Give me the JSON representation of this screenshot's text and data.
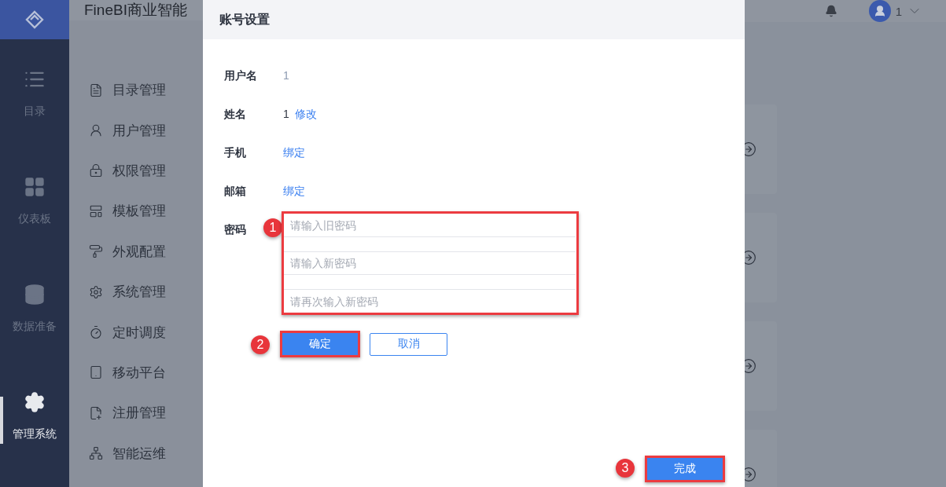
{
  "app": {
    "title": "FineBI商业智能"
  },
  "rail": [
    {
      "label": "目录",
      "selected": false
    },
    {
      "label": "仪表板",
      "selected": false
    },
    {
      "label": "数据准备",
      "selected": false
    },
    {
      "label": "管理系统",
      "selected": true
    }
  ],
  "menu": [
    {
      "label": "目录管理"
    },
    {
      "label": "用户管理"
    },
    {
      "label": "权限管理"
    },
    {
      "label": "模板管理"
    },
    {
      "label": "外观配置"
    },
    {
      "label": "系统管理"
    },
    {
      "label": "定时调度"
    },
    {
      "label": "移动平台"
    },
    {
      "label": "注册管理"
    },
    {
      "label": "智能运维"
    }
  ],
  "header": {
    "user": "1"
  },
  "dialog": {
    "title": "账号设置",
    "fields": [
      {
        "kind": "plain",
        "label": "用户名",
        "value": "1"
      },
      {
        "kind": "editable",
        "label": "姓名",
        "value": "1",
        "link": "修改"
      },
      {
        "kind": "link",
        "label": "手机",
        "link": "绑定"
      },
      {
        "kind": "link",
        "label": "邮箱",
        "link": "绑定"
      }
    ],
    "password": {
      "label": "密码",
      "callout": "1",
      "inputs": [
        {
          "placeholder": "请输入旧密码"
        },
        {
          "placeholder": "请输入新密码"
        },
        {
          "placeholder": "请再次输入新密码"
        }
      ]
    },
    "confirm": {
      "label": "确定",
      "callout": "2"
    },
    "cancel": {
      "label": "取消"
    },
    "done": {
      "label": "完成",
      "callout": "3"
    }
  }
}
